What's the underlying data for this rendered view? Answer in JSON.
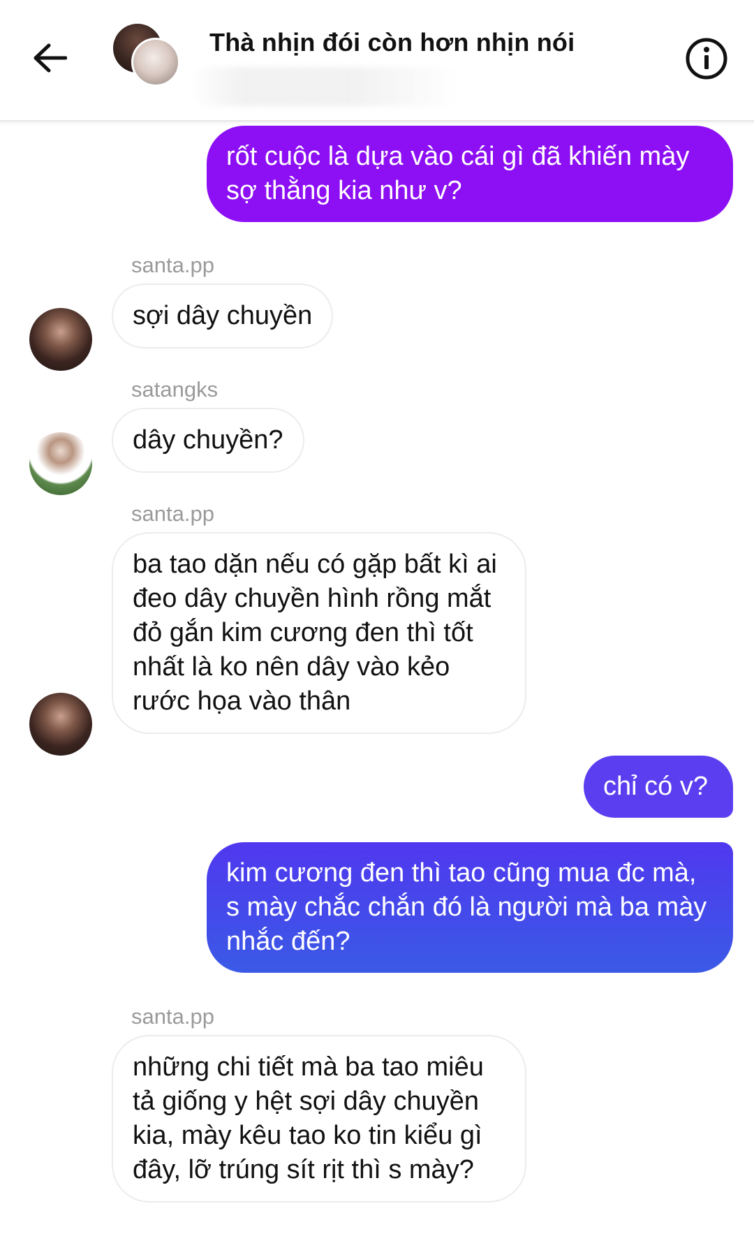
{
  "header": {
    "back_icon": "arrow-left-icon",
    "title": "Thà nhịn đói còn hơn nhịn nói",
    "info_icon": "info-circle-icon"
  },
  "messages": [
    {
      "direction": "outgoing",
      "sender": "",
      "text": "rốt cuộc là dựa vào cái gì đã khiến mày sợ thằng kia như v?"
    },
    {
      "direction": "incoming",
      "sender": "santa.pp",
      "text": "sợi dây chuyền"
    },
    {
      "direction": "incoming",
      "sender": "satangks",
      "text": "dây chuyền?"
    },
    {
      "direction": "incoming",
      "sender": "santa.pp",
      "text": "ba tao dặn nếu có gặp bất kì ai đeo dây chuyền hình rồng mắt đỏ gắn kim cương đen thì tốt nhất là ko nên dây vào kẻo rước họa vào thân"
    },
    {
      "direction": "outgoing",
      "sender": "",
      "text": "chỉ có v?"
    },
    {
      "direction": "outgoing",
      "sender": "",
      "text": "kim cương đen thì tao cũng mua đc mà, s mày chắc chắn đó là người mà ba mày nhắc đến?"
    },
    {
      "direction": "incoming",
      "sender": "santa.pp",
      "text": "những chi tiết mà ba tao miêu tả giống y hệt sợi dây chuyền kia, mày kêu tao ko tin kiểu gì đây, lỡ trúng sít rịt thì s mày?"
    }
  ],
  "colors": {
    "outgoing_purple": "#8d0ff4",
    "outgoing_violet": "#5b3ef0",
    "outgoing_blue": "#3a5ae6",
    "sender_gray": "#9a9a9a"
  }
}
